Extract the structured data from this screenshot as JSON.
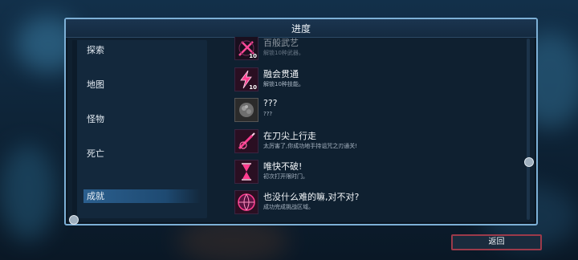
{
  "panel": {
    "title": "进度"
  },
  "categories": [
    {
      "label": "探索",
      "selected": false
    },
    {
      "label": "地图",
      "selected": false
    },
    {
      "label": "怪物",
      "selected": false
    },
    {
      "label": "死亡",
      "selected": false
    },
    {
      "label": "成就",
      "selected": true
    }
  ],
  "achievements": [
    {
      "name": "百般武艺",
      "desc": "解锁10种武器。",
      "icon": "crossed-swords-icon",
      "badge": "10"
    },
    {
      "name": "融会贯通",
      "desc": "解锁10种技能。",
      "icon": "lightning-icon",
      "badge": "10"
    },
    {
      "name": "???",
      "desc": "???",
      "icon": "locked-mystery-icon",
      "badge": ""
    },
    {
      "name": "在刀尖上行走",
      "desc": "太厉害了,你成功地手持诅咒之刃通关!",
      "icon": "cursed-blade-icon",
      "badge": ""
    },
    {
      "name": "唯快不破!",
      "desc": "初次打开限时门。",
      "icon": "hourglass-icon",
      "badge": ""
    },
    {
      "name": "也没什么难的嘛,对不对?",
      "desc": "成功完成挑战区域。",
      "icon": "challenge-orb-icon",
      "badge": ""
    }
  ],
  "footer": {
    "back_label": "返回"
  },
  "colors": {
    "accent_pink": "#ff3d8f",
    "panel_border": "#7db0d6",
    "back_border": "#9c3a4a"
  }
}
